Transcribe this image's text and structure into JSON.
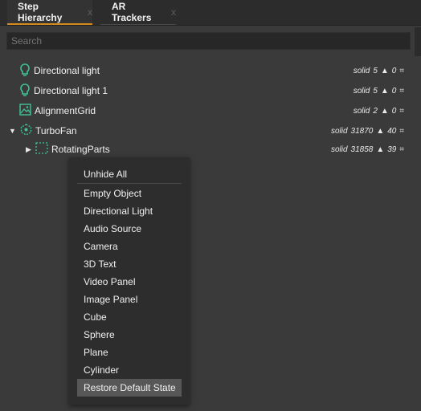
{
  "tabs": [
    {
      "label": "Step Hierarchy",
      "close": "x"
    },
    {
      "label": "AR Trackers",
      "close": "x"
    }
  ],
  "search": {
    "placeholder": "Search"
  },
  "rows": [
    {
      "name": "Directional light",
      "mode": "solid",
      "a": "5",
      "b": "0",
      "icon": "light-bulb-icon"
    },
    {
      "name": "Directional light 1",
      "mode": "solid",
      "a": "5",
      "b": "0",
      "icon": "light-bulb-icon"
    },
    {
      "name": "AlignmentGrid",
      "mode": "solid",
      "a": "2",
      "b": "0",
      "icon": "image-icon"
    },
    {
      "name": "TurboFan",
      "mode": "solid",
      "a": "31870",
      "b": "40",
      "icon": "model-icon"
    },
    {
      "name": "RotatingParts",
      "mode": "solid",
      "a": "31858",
      "b": "39",
      "icon": "group-icon"
    }
  ],
  "menu": {
    "items": [
      "Unhide All",
      "Empty Object",
      "Directional Light",
      "Audio Source",
      "Camera",
      "3D Text",
      "Video Panel",
      "Image Panel",
      "Cube",
      "Sphere",
      "Plane",
      "Cylinder",
      "Restore Default State"
    ]
  },
  "colors": {
    "accent": "#d68a1e",
    "icon_green": "#3fc49a"
  }
}
